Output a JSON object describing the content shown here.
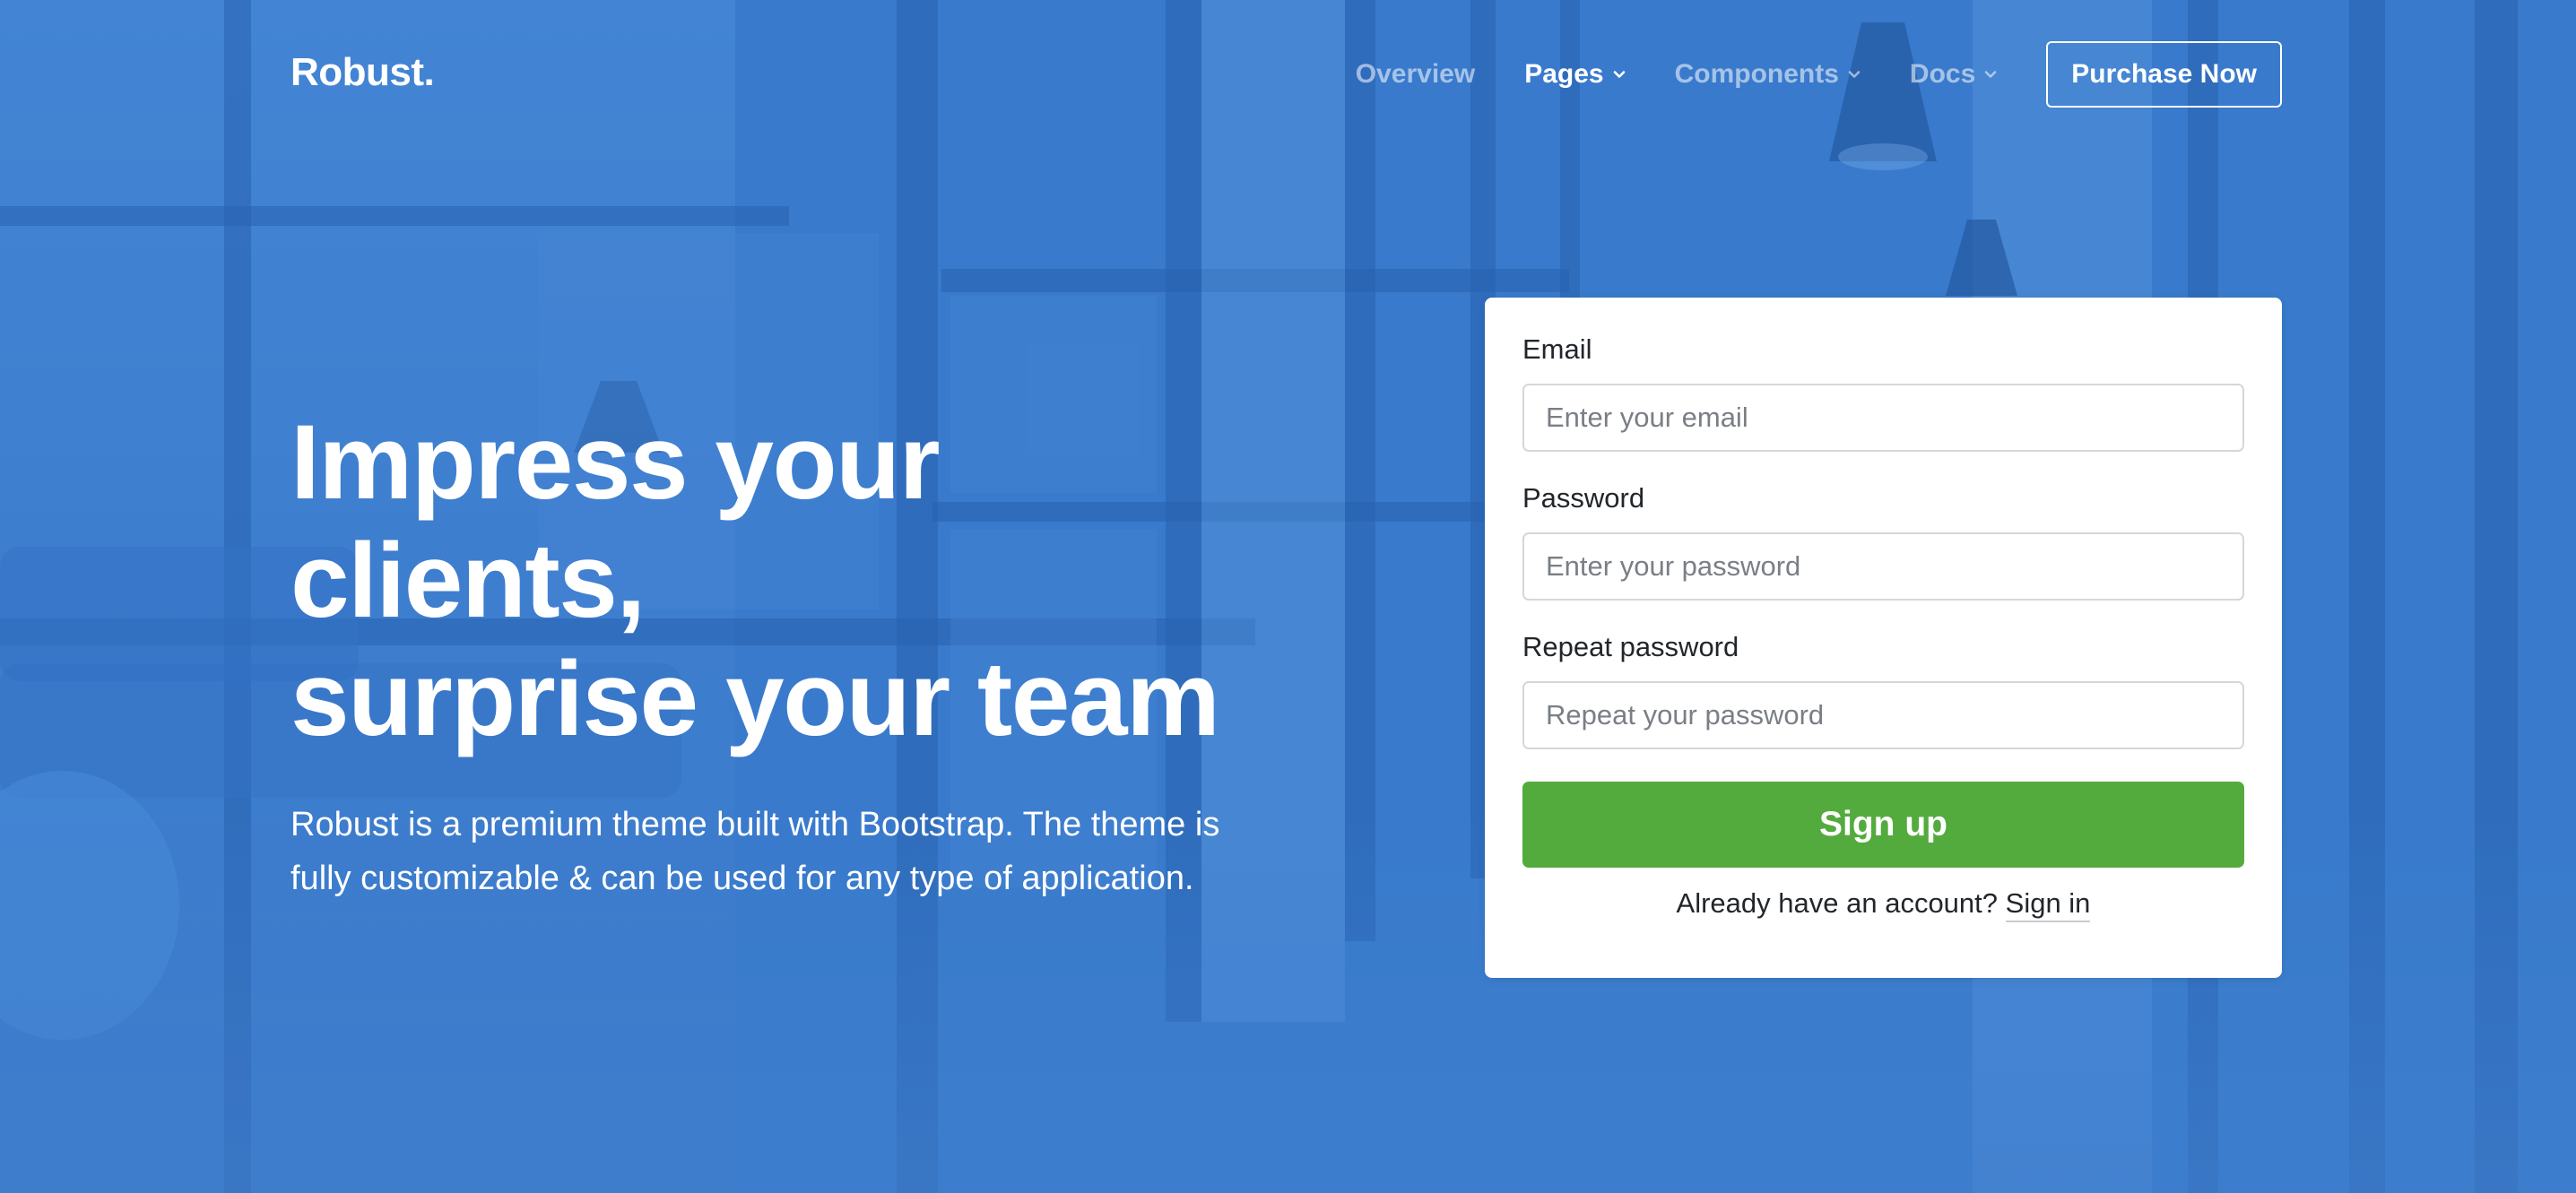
{
  "brand": "Robust.",
  "nav": {
    "items": [
      {
        "label": "Overview",
        "dropdown": false,
        "active": false
      },
      {
        "label": "Pages",
        "dropdown": true,
        "active": true
      },
      {
        "label": "Components",
        "dropdown": true,
        "active": false
      },
      {
        "label": "Docs",
        "dropdown": true,
        "active": false
      }
    ],
    "cta_label": "Purchase Now"
  },
  "hero": {
    "title_line1": "Impress your clients,",
    "title_line2": "surprise your team",
    "description": "Robust is a premium theme built with Bootstrap. The theme is fully customizable & can be used for any type of application."
  },
  "form": {
    "email_label": "Email",
    "email_placeholder": "Enter your email",
    "password_label": "Password",
    "password_placeholder": "Enter your password",
    "repeat_label": "Repeat password",
    "repeat_placeholder": "Repeat your password",
    "submit_label": "Sign up",
    "signin_prompt": "Already have an account?",
    "signin_link": "Sign in"
  },
  "colors": {
    "background_tint": "#3f7fcf",
    "primary_button": "#53ab3d",
    "card": "#ffffff"
  }
}
